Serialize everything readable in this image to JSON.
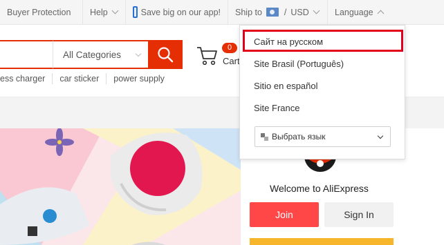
{
  "topbar": {
    "buyer_protection": "Buyer Protection",
    "help": "Help",
    "app_promo": "Save big on our app!",
    "ship_to": "Ship to",
    "currency_sep": "/",
    "currency": "USD",
    "language": "Language"
  },
  "search": {
    "placeholder": "",
    "category": "All Categories"
  },
  "cart": {
    "count": "0",
    "label": "Cart"
  },
  "hot_searches": [
    "ess charger",
    "car sticker",
    "power supply"
  ],
  "language_menu": {
    "items": [
      "Сайт на русском",
      "Site Brasil (Português)",
      "Sitio en español",
      "Site France"
    ],
    "select_label": "Выбрать язык"
  },
  "user_panel": {
    "welcome": "Welcome to AliExpress",
    "join": "Join",
    "sign_in": "Sign In"
  },
  "colors": {
    "brand_red": "#e62e04",
    "highlight": "#e3001b",
    "join_red": "#ff4747"
  }
}
